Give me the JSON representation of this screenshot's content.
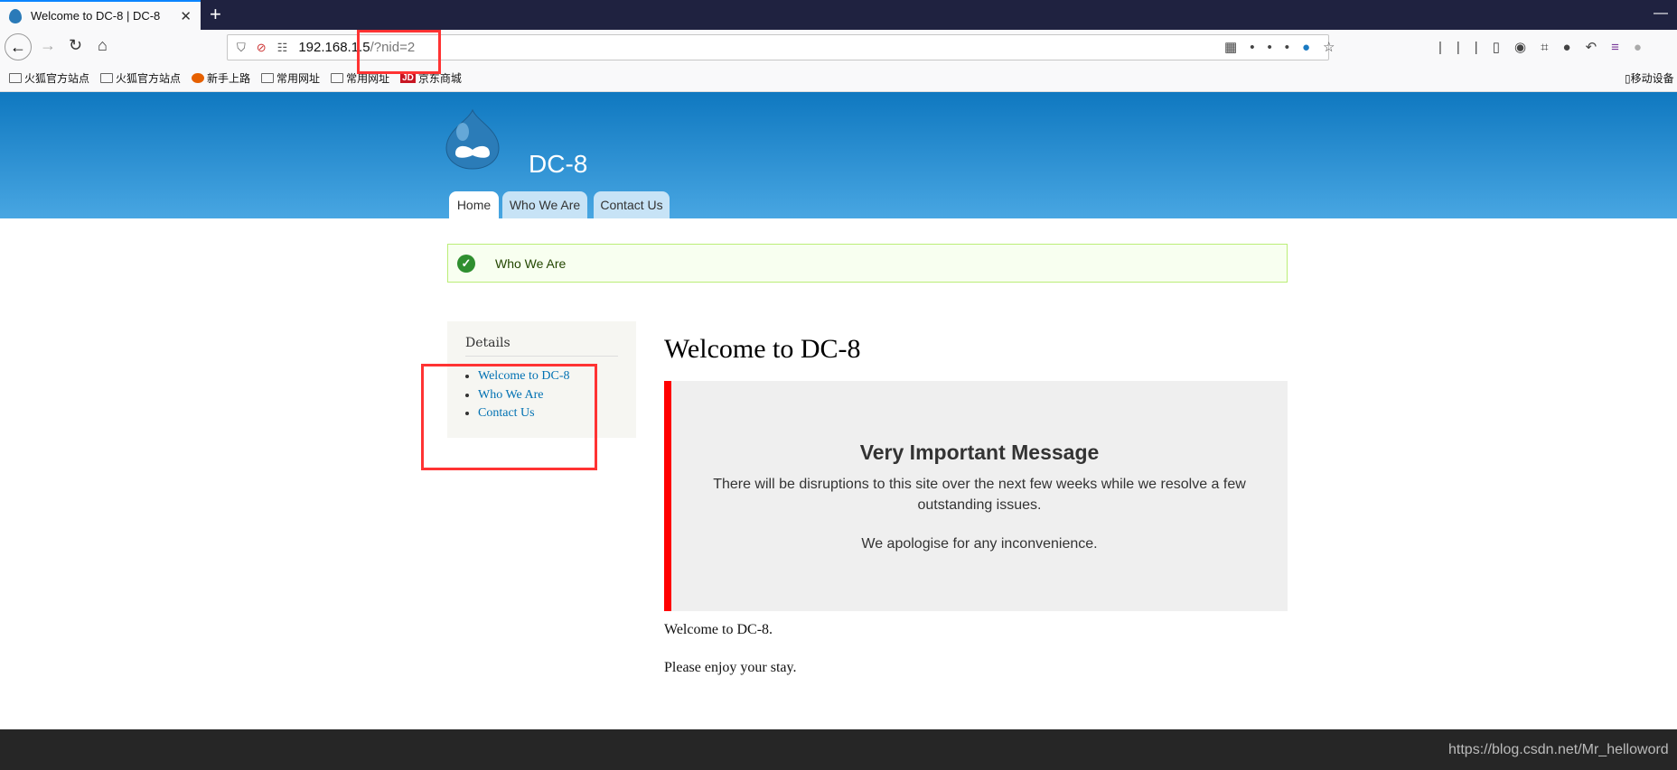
{
  "browser": {
    "tab_title": "Welcome to DC-8 | DC-8",
    "new_tab": "+",
    "url_host": "192.168.1.5",
    "url_path": "/?nid=2",
    "bookmarks": [
      "火狐官方站点",
      "火狐官方站点",
      "新手上路",
      "常用网址",
      "常用网址",
      "京东商城"
    ],
    "mobile_bookmarks": "移动设备"
  },
  "site": {
    "name": "DC-8",
    "tabs": [
      {
        "label": "Home",
        "active": true
      },
      {
        "label": "Who We Are"
      },
      {
        "label": "Contact Us"
      }
    ],
    "status_message": "Who We Are",
    "sidebar": {
      "title": "Details",
      "links": [
        "Welcome to DC-8",
        "Who We Are",
        "Contact Us"
      ]
    },
    "page_title": "Welcome to DC-8",
    "important": {
      "heading": "Very Important Message",
      "para1": "There will be disruptions to this site over the next few weeks while we resolve a few outstanding issues.",
      "para2": "We apologise for any inconvenience."
    },
    "body": [
      "Welcome to DC-8.",
      "Please enjoy your stay."
    ]
  },
  "watermark": "https://blog.csdn.net/Mr_helloword",
  "colors": {
    "accent": "#0071b3",
    "alert_bar": "#ff0000",
    "annotation": "#ff3333"
  }
}
